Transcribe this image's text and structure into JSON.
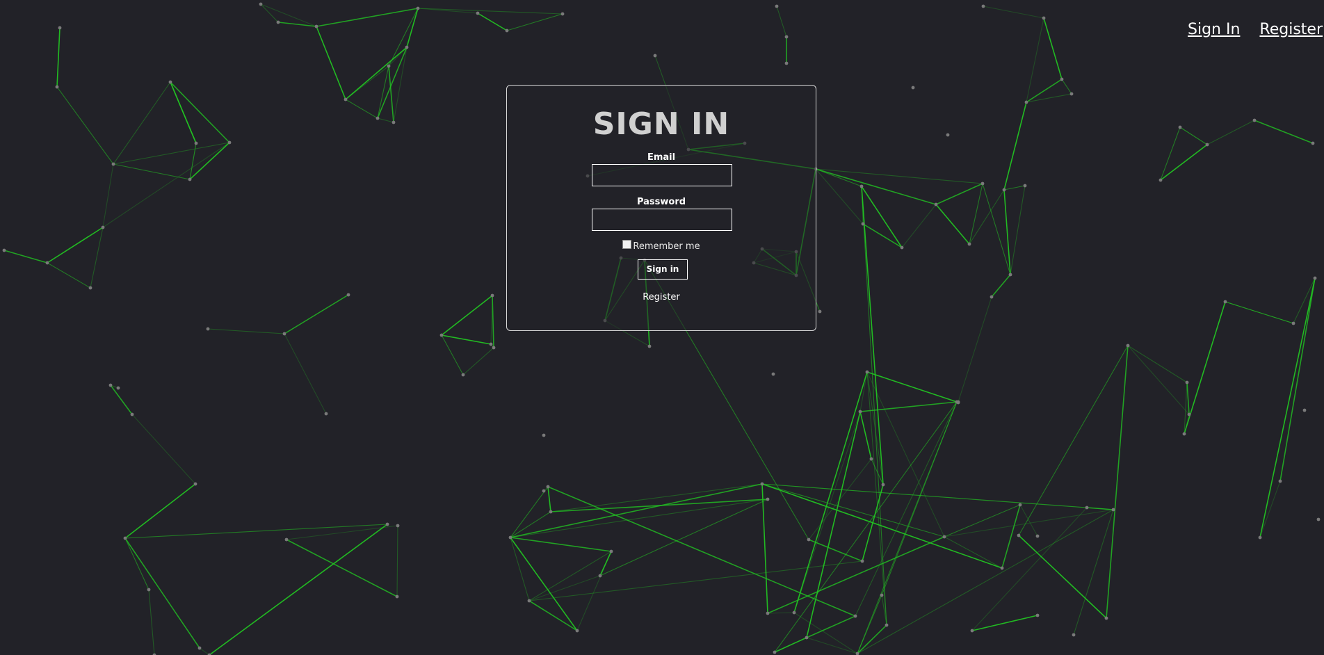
{
  "nav": {
    "sign_in_label": "Sign In",
    "register_label": "Register"
  },
  "form": {
    "title": "SIGN IN",
    "email_label": "Email",
    "email_value": "",
    "password_label": "Password",
    "password_value": "",
    "remember_label": "Remember me",
    "remember_checked": false,
    "submit_label": "Sign in",
    "register_link": "Register"
  },
  "colors": {
    "background": "#222228",
    "network_line": "#22c322",
    "network_node": "#7a7a7a",
    "text": "#ffffff",
    "title": "#d0d0d0"
  }
}
